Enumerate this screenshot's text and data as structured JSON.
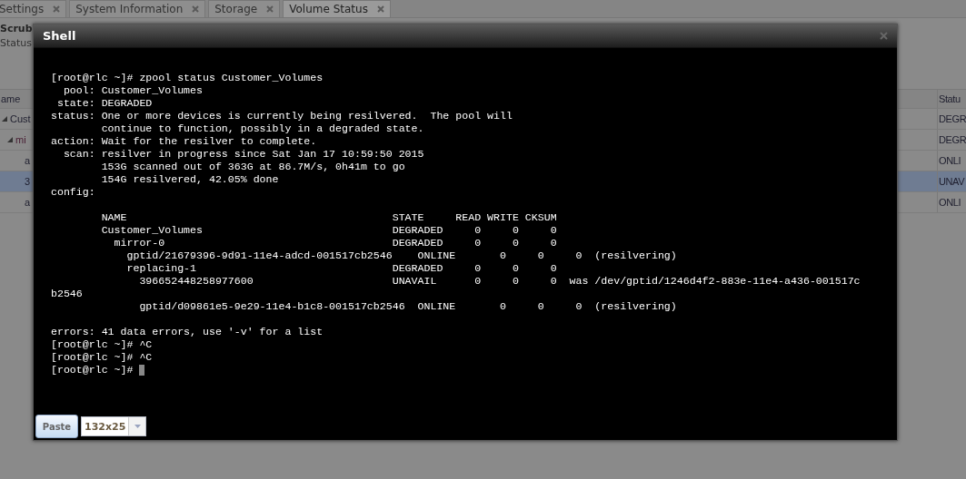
{
  "tabs": [
    {
      "label": "Settings",
      "selected": false
    },
    {
      "label": "System Information",
      "selected": false
    },
    {
      "label": "Storage",
      "selected": false
    },
    {
      "label": "Volume Status",
      "selected": true
    }
  ],
  "page": {
    "heading": "Scrub",
    "subheading": "Status"
  },
  "table": {
    "columns": [
      "ame",
      "Statu"
    ],
    "rows": [
      {
        "name": "Cust",
        "status": "DEGR",
        "expanded": true,
        "selected": false,
        "children": [
          {
            "name": "mi",
            "status": "DEGR",
            "expanded": true,
            "selected": false,
            "children": [
              {
                "name": "a",
                "status": "ONLI",
                "selected": false
              },
              {
                "name": "3",
                "status": "UNAV",
                "selected": true
              },
              {
                "name": "a",
                "status": "ONLI",
                "selected": false
              }
            ]
          }
        ]
      }
    ]
  },
  "shell": {
    "title": "Shell",
    "blocks": [
      [
        "[root@rlc ~]# zpool status Customer_Volumes",
        "  pool: Customer_Volumes",
        " state: DEGRADED",
        "status: One or more devices is currently being resilvered.  The pool will",
        "        continue to function, possibly in a degraded state.",
        "action: Wait for the resilver to complete.",
        "  scan: resilver in progress since Sat Jan 17 10:59:50 2015",
        "        153G scanned out of 363G at 86.7M/s, 0h41m to go",
        "        154G resilvered, 42.05% done",
        "config:"
      ],
      [
        "        NAME                                          STATE     READ WRITE CKSUM",
        "        Customer_Volumes                              DEGRADED     0     0     0",
        "          mirror-0                                    DEGRADED     0     0     0",
        "            gptid/21679396-9d91-11e4-adcd-001517cb2546    ONLINE       0     0     0  (resilvering)",
        "            replacing-1                               DEGRADED     0     0     0",
        "              396652448258977600                      UNAVAIL      0     0     0  was /dev/gptid/1246d4f2-883e-11e4-a436-001517c",
        "b2546",
        "              gptid/d09861e5-9e29-11e4-b1c8-001517cb2546  ONLINE       0     0     0  (resilvering)"
      ],
      [
        "errors: 41 data errors, use '-v' for a list",
        "[root@rlc ~]# ^C",
        "[root@rlc ~]# ^C",
        "[root@rlc ~]# "
      ]
    ],
    "paste_button": "Paste",
    "size_select": {
      "value": "132x25"
    }
  }
}
